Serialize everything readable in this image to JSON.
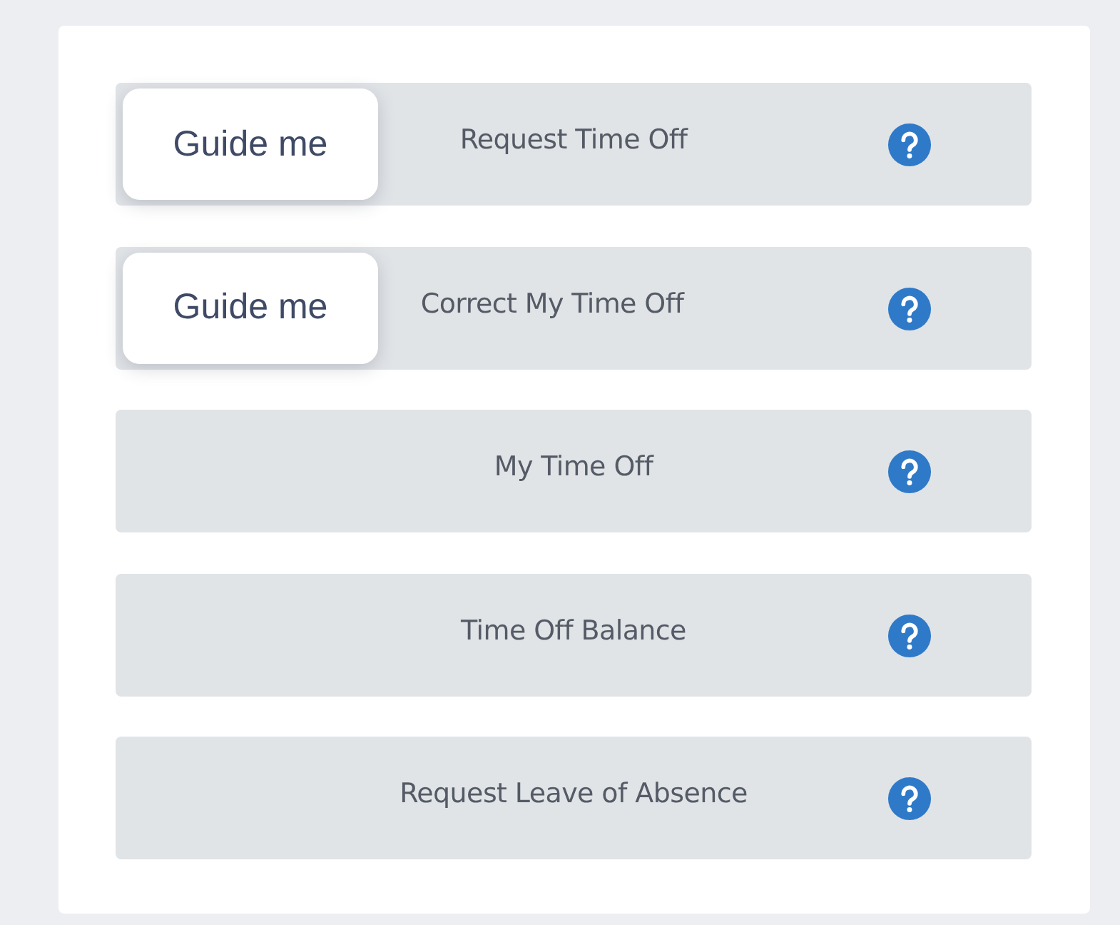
{
  "actions": [
    {
      "label": "Request Time Off",
      "guide": "Guide me"
    },
    {
      "label": "Correct My Time Off",
      "guide": "Guide me"
    },
    {
      "label": "My Time Off"
    },
    {
      "label": "Time Off Balance"
    },
    {
      "label": "Request Leave of Absence"
    }
  ]
}
